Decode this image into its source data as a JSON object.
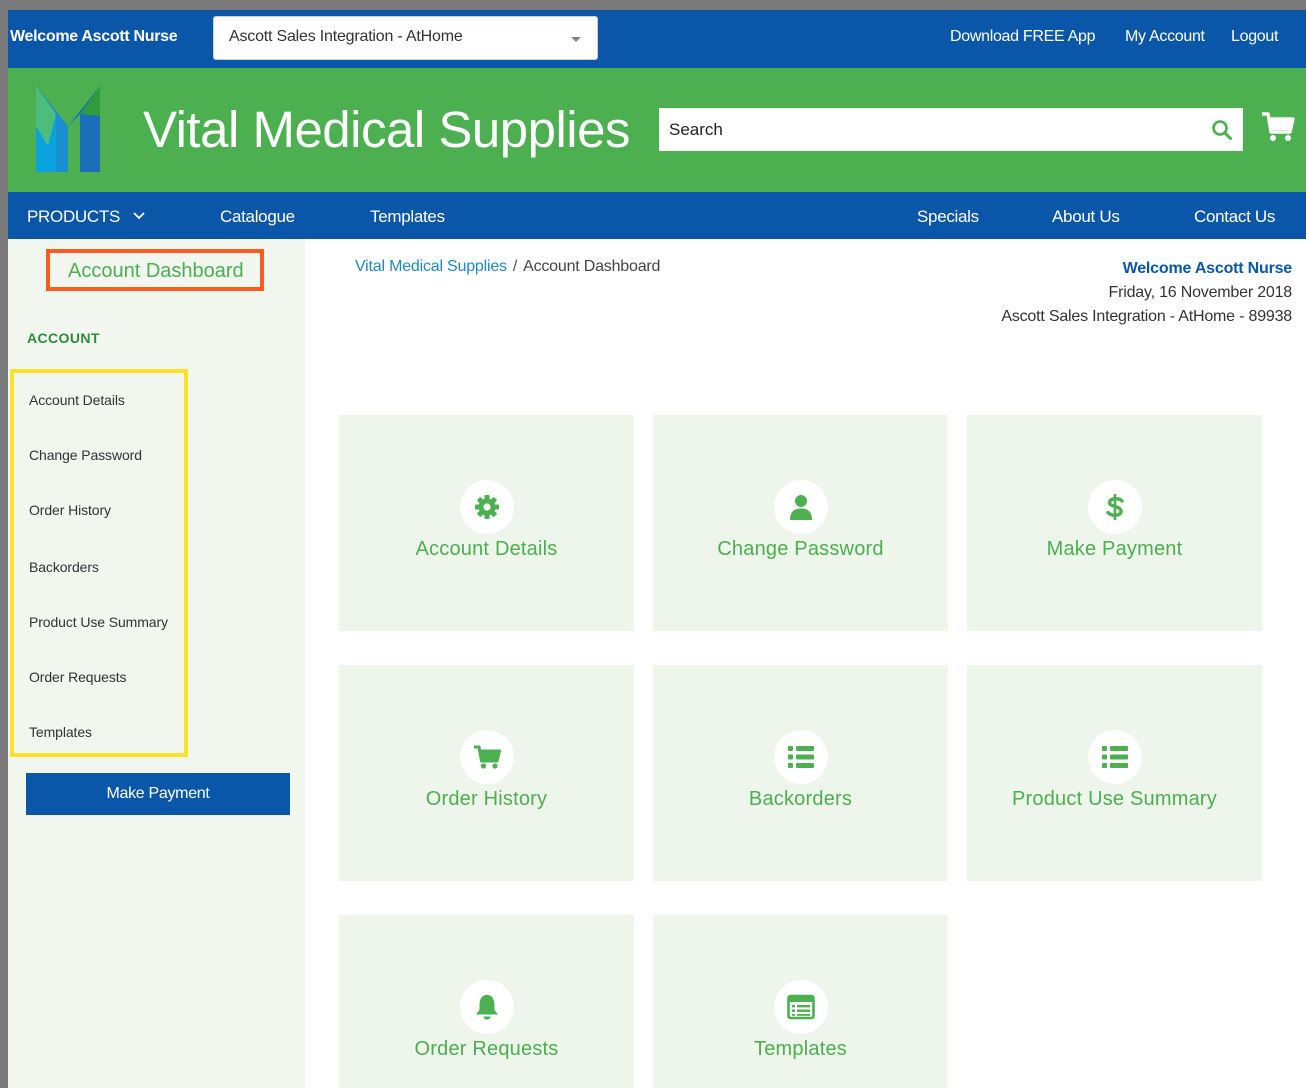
{
  "topbar": {
    "welcome": "Welcome Ascott Nurse",
    "account_selector": "Ascott Sales Integration - AtHome",
    "links": [
      "Download FREE App",
      "My Account",
      "Logout"
    ]
  },
  "header": {
    "brand": "Vital Medical Supplies",
    "search_placeholder": "Search"
  },
  "nav": {
    "products": "PRODUCTS",
    "catalogue": "Catalogue",
    "templates": "Templates",
    "specials": "Specials",
    "about": "About Us",
    "contact": "Contact Us"
  },
  "sidebar": {
    "title": "Account Dashboard",
    "section_heading": "ACCOUNT",
    "items": [
      "Account Details",
      "Change Password",
      "Order History",
      "Backorders",
      "Product Use Summary",
      "Order Requests",
      "Templates"
    ],
    "make_payment": "Make Payment"
  },
  "breadcrumb": {
    "home": "Vital Medical Supplies",
    "separator": "/",
    "current": "Account Dashboard"
  },
  "welcome_block": {
    "name": "Welcome Ascott Nurse",
    "date": "Friday, 16 November 2018",
    "account": "Ascott Sales Integration - AtHome - 89938"
  },
  "tiles": [
    {
      "label": "Account Details",
      "icon": "gear-icon"
    },
    {
      "label": "Change Password",
      "icon": "user-icon"
    },
    {
      "label": "Make Payment",
      "icon": "dollar-icon"
    },
    {
      "label": "Order History",
      "icon": "cart-icon"
    },
    {
      "label": "Backorders",
      "icon": "list-icon"
    },
    {
      "label": "Product Use Summary",
      "icon": "list-icon"
    },
    {
      "label": "Order Requests",
      "icon": "bell-icon"
    },
    {
      "label": "Templates",
      "icon": "template-icon"
    }
  ],
  "colors": {
    "primary_blue": "#0a57a9",
    "brand_green": "#4caf50",
    "highlight_orange": "#ff5a1f",
    "highlight_yellow": "#ffe12b"
  }
}
